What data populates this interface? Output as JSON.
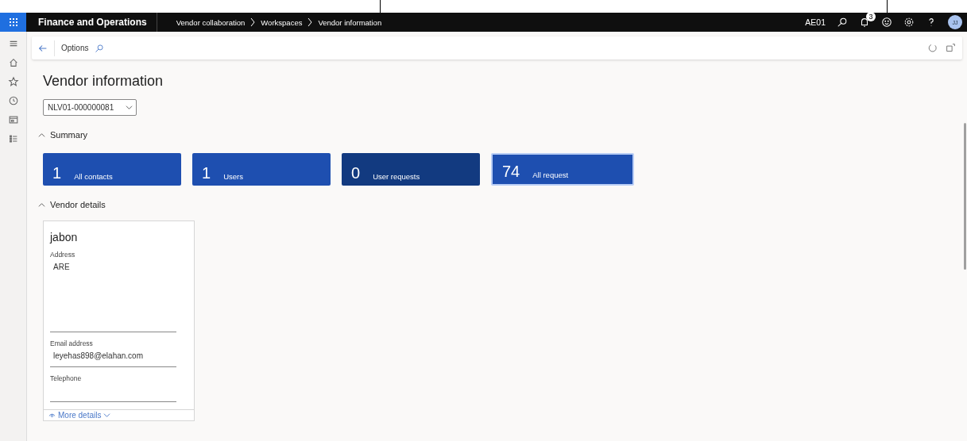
{
  "app": {
    "title": "Finance and Operations"
  },
  "breadcrumbs": [
    "Vendor collaboration",
    "Workspaces",
    "Vendor information"
  ],
  "header": {
    "company": "AE01",
    "notification_count": "3",
    "avatar": "JJ"
  },
  "toolbar": {
    "label": "Options"
  },
  "page": {
    "title": "Vendor information",
    "vendor_select": {
      "value": "NLV01-000000081"
    }
  },
  "sections": [
    {
      "title": "Summary",
      "expanded": true
    },
    {
      "title": "Vendor details",
      "expanded": true
    }
  ],
  "tiles": [
    {
      "count": "1",
      "label": "All contacts",
      "hovered": false,
      "selected": false
    },
    {
      "count": "1",
      "label": "Users",
      "hovered": false,
      "selected": false
    },
    {
      "count": "0",
      "label": "User requests",
      "hovered": true,
      "selected": false
    },
    {
      "count": "74",
      "label": "All request",
      "hovered": false,
      "selected": true
    }
  ],
  "vendor_card": {
    "name": "jabon",
    "fields": [
      {
        "label": "Address",
        "value": "ARE",
        "kind": "multiline"
      },
      {
        "label": "Email address",
        "value": "leyehas898@elahan.com",
        "kind": "line"
      },
      {
        "label": "Telephone",
        "kind": "line"
      }
    ],
    "more_details": "More details"
  }
}
